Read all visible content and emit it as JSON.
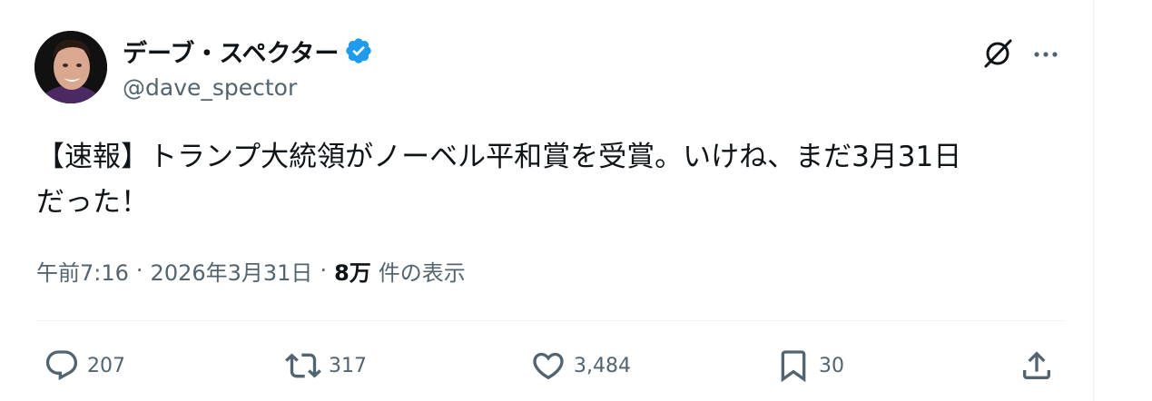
{
  "author": {
    "name": "デーブ・スペクター",
    "handle": "@dave_spector",
    "verified": true,
    "avatar": "avatar-photo"
  },
  "header_icons": [
    "grok-icon",
    "more-icon"
  ],
  "tweet": {
    "text": "【速報】トランプ大統領がノーベル平和賞を受賞。いけね、まだ3月31日\nだった！"
  },
  "meta": {
    "time": "午前7:16",
    "separator": "·",
    "date": "2026年3月31日",
    "views_count": "8万",
    "views_label": "件の表示"
  },
  "actions": {
    "reply": {
      "icon": "reply-icon",
      "count": "207"
    },
    "retweet": {
      "icon": "retweet-icon",
      "count": "317"
    },
    "like": {
      "icon": "heart-icon",
      "count": "3,484"
    },
    "bookmark": {
      "icon": "bookmark-icon",
      "count": "30"
    },
    "share": {
      "icon": "share-icon"
    }
  },
  "colors": {
    "text_primary": "#0f1419",
    "text_secondary": "#536471",
    "verified_blue": "#1d9bf0",
    "divider": "#eff3f4"
  }
}
